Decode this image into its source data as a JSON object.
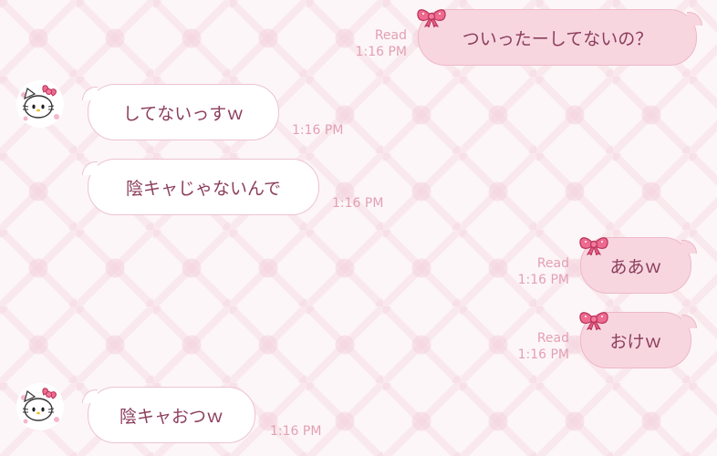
{
  "theme": {
    "bubble_out": "#f7d6e0",
    "bubble_in": "#ffffff",
    "text": "#8c3d5c",
    "meta": "#e2a0b4",
    "bow": "#e8577f"
  },
  "messages": [
    {
      "side": "out",
      "text": "ついったーしてないの？",
      "read": "Read",
      "time": "1:16 PM"
    },
    {
      "side": "in",
      "text": "してないっすｗ",
      "time": "1:16 PM"
    },
    {
      "side": "in",
      "text": "陰キャじゃないんで",
      "time": "1:16 PM"
    },
    {
      "side": "out",
      "text": "ああｗ",
      "read": "Read",
      "time": "1:16 PM"
    },
    {
      "side": "out",
      "text": "おけｗ",
      "read": "Read",
      "time": "1:16 PM"
    },
    {
      "side": "in",
      "text": "陰キャおつｗ",
      "time": "1:16 PM"
    }
  ],
  "icons": {
    "bow": "ribbon-bow-icon",
    "avatar": "hello-kitty-avatar"
  }
}
